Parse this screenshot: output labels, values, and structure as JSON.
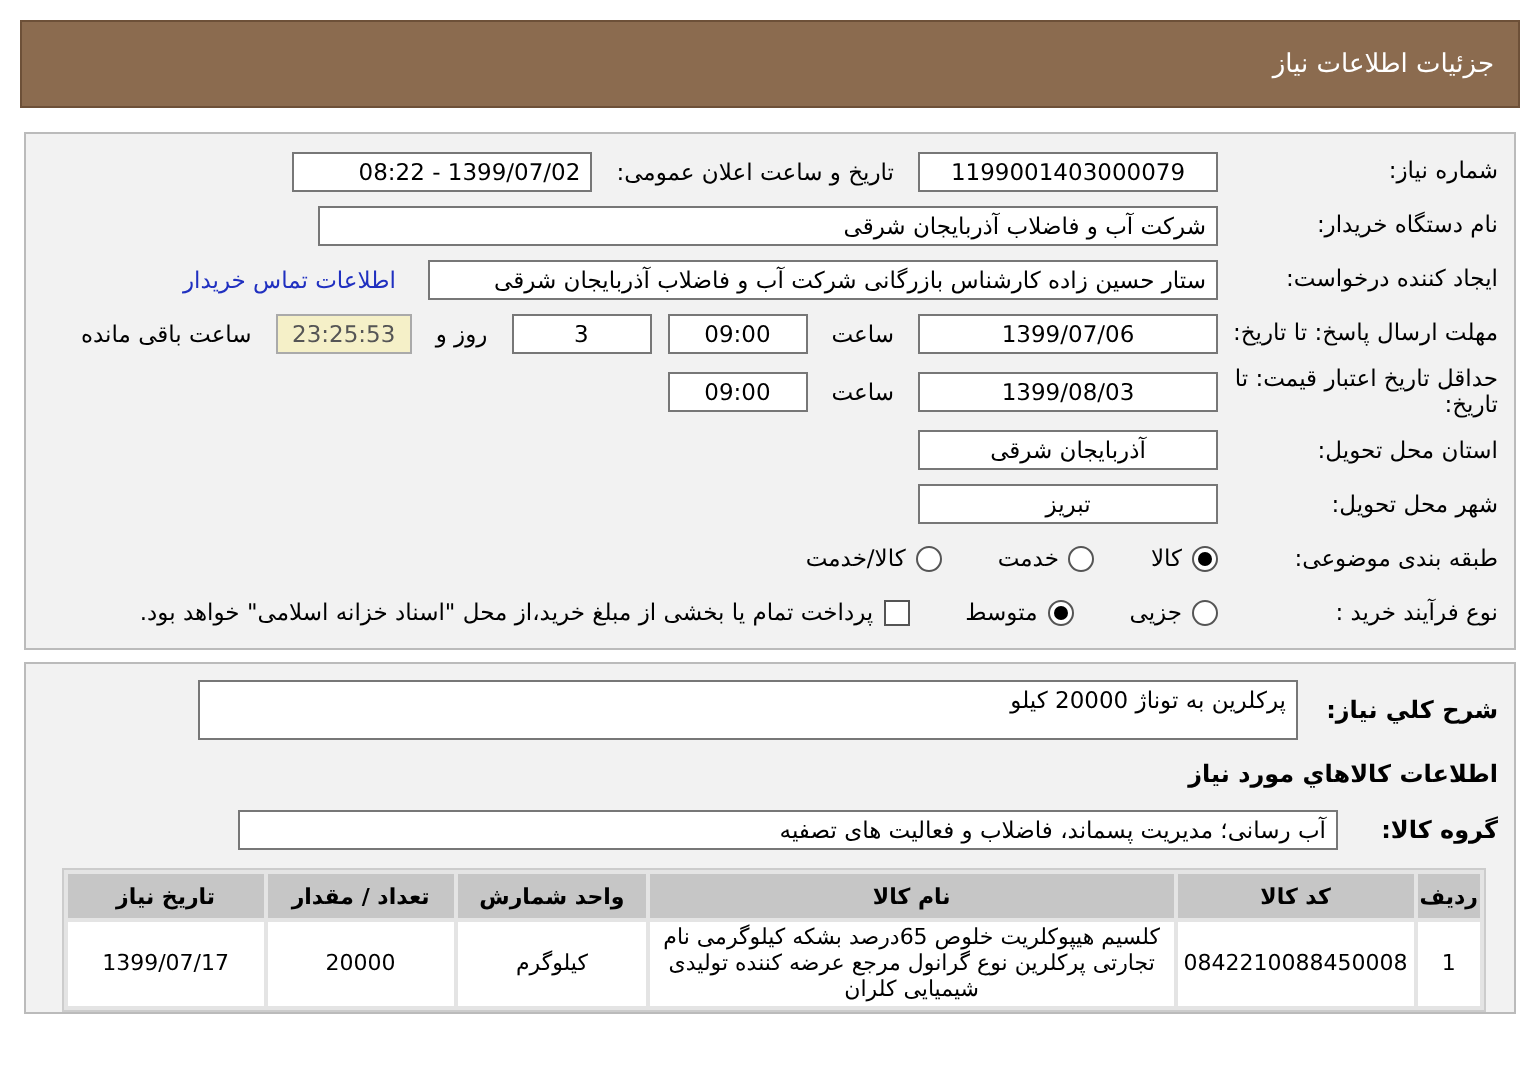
{
  "header": {
    "title": "جزئیات اطلاعات نیاز"
  },
  "details": {
    "rows": [
      {
        "label": "شماره نیاز:",
        "items": [
          {
            "kind": "field",
            "value": "1199001403000079"
          },
          {
            "kind": "label",
            "text": "تاریخ و ساعت اعلان عمومی:"
          },
          {
            "kind": "field",
            "value": "1399/07/02 - 08:22"
          }
        ]
      },
      {
        "label": "نام دستگاه خریدار:",
        "items": [
          {
            "kind": "wide",
            "value": "شرکت آب و فاضلاب آذربایجان شرقی"
          }
        ]
      },
      {
        "label": "ایجاد کننده درخواست:",
        "items": [
          {
            "kind": "medium",
            "value": "ستار حسین زاده کارشناس بازرگانی شرکت آب و فاضلاب آذربایجان شرقی"
          },
          {
            "kind": "link",
            "text": "اطلاعات تماس خریدار"
          }
        ]
      },
      {
        "label": "مهلت ارسال پاسخ: تا تاریخ:",
        "items": [
          {
            "kind": "field",
            "value": "1399/07/06"
          },
          {
            "kind": "label",
            "text": "ساعت"
          },
          {
            "kind": "short",
            "value": "09:00"
          },
          {
            "kind": "short",
            "value": "3"
          },
          {
            "kind": "label",
            "text": "روز و"
          },
          {
            "kind": "timer",
            "value": "23:25:53"
          },
          {
            "kind": "label",
            "text": "ساعت باقی مانده"
          }
        ]
      },
      {
        "label": "حداقل تاریخ اعتبار قیمت: تا تاریخ:",
        "items": [
          {
            "kind": "field",
            "value": "1399/08/03"
          },
          {
            "kind": "label",
            "text": "ساعت"
          },
          {
            "kind": "short",
            "value": "09:00"
          }
        ]
      },
      {
        "label": "استان محل تحویل:",
        "items": [
          {
            "kind": "field",
            "value": "آذربایجان شرقی"
          }
        ]
      },
      {
        "label": "شهر محل تحویل:",
        "items": [
          {
            "kind": "field",
            "value": "تبریز"
          }
        ]
      },
      {
        "label": "طبقه بندی موضوعی:",
        "items": [
          {
            "kind": "radio",
            "text": "کالا",
            "selected": true
          },
          {
            "kind": "radio",
            "text": "خدمت",
            "selected": false
          },
          {
            "kind": "radio",
            "text": "کالا/خدمت",
            "selected": false
          }
        ]
      },
      {
        "label": "نوع فرآیند خرید :",
        "items": [
          {
            "kind": "radio",
            "text": "جزیی",
            "selected": false
          },
          {
            "kind": "radio",
            "text": "متوسط",
            "selected": true
          },
          {
            "kind": "checkbox",
            "text": "پرداخت تمام یا بخشی از مبلغ خرید،از محل \"اسناد خزانه اسلامی\" خواهد بود.",
            "checked": false
          }
        ]
      }
    ]
  },
  "needs": {
    "description_label": "شرح کلي نياز:",
    "description": "پرکلرین به توناژ 20000 کیلو",
    "goods_heading": "اطلاعات کالاهاي مورد نياز",
    "group_label": "گروه کالا:",
    "group": "آب رسانی؛ مدیریت پسماند، فاضلاب و فعالیت های تصفیه",
    "table": {
      "columns": [
        "ردیف",
        "کد کالا",
        "نام کالا",
        "واحد شمارش",
        "تعداد / مقدار",
        "تاریخ نیاز"
      ],
      "rows": [
        [
          "1",
          "0842210088450008",
          "کلسیم هیپوکلریت خلوص 65درصد بشکه کیلوگرمی نام تجارتی پرکلرین نوع گرانول مرجع عرضه کننده تولیدی شیمیایی کلران",
          "کیلوگرم",
          "20000",
          "1399/07/17"
        ]
      ]
    }
  }
}
